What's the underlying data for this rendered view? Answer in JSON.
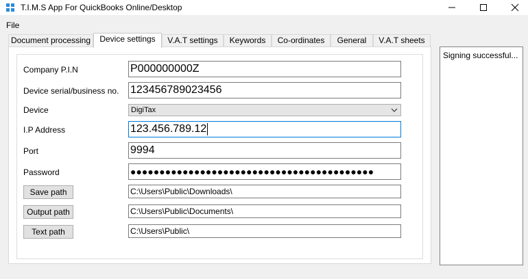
{
  "window": {
    "title": "T.I.M.S App For QuickBooks Online/Desktop",
    "icon": "app-logo-icon",
    "controls": [
      "minimize-icon",
      "maximize-icon",
      "close-icon"
    ]
  },
  "menu": {
    "file": "File"
  },
  "tabs": [
    {
      "label": "Document processing",
      "active": false
    },
    {
      "label": "Device settings",
      "active": true
    },
    {
      "label": "V.A.T settings",
      "active": false
    },
    {
      "label": "Keywords",
      "active": false
    },
    {
      "label": "Co-ordinates",
      "active": false
    },
    {
      "label": "General",
      "active": false
    },
    {
      "label": "V.A.T sheets",
      "active": false
    }
  ],
  "form": {
    "company_pin": {
      "label": "Company P.I.N",
      "value": "P000000000Z"
    },
    "device_serial": {
      "label": "Device serial/business no.",
      "value": "123456789023456"
    },
    "device": {
      "label": "Device",
      "selected": "DigiTax"
    },
    "ip_address": {
      "label": "I.P Address",
      "value": "123.456.789.12"
    },
    "port": {
      "label": "Port",
      "value": "9994"
    },
    "password": {
      "label": "Password",
      "value": "●●●●●●●●●●●●●●●●●●●●●●●●●●●●●●●●●●●●●●●●●●"
    },
    "save_path": {
      "button": "Save path",
      "value": "C:\\Users\\Public\\Downloads\\"
    },
    "output_path": {
      "button": "Output path",
      "value": "C:\\Users\\Public\\Documents\\"
    },
    "text_path": {
      "button": "Text path",
      "value": "C:\\Users\\Public\\"
    }
  },
  "status": {
    "text": "Signing successful..."
  },
  "colors": {
    "focus_border": "#0078d7",
    "tab_active": "#ffffff",
    "window_bg": "#f0f0f0"
  }
}
